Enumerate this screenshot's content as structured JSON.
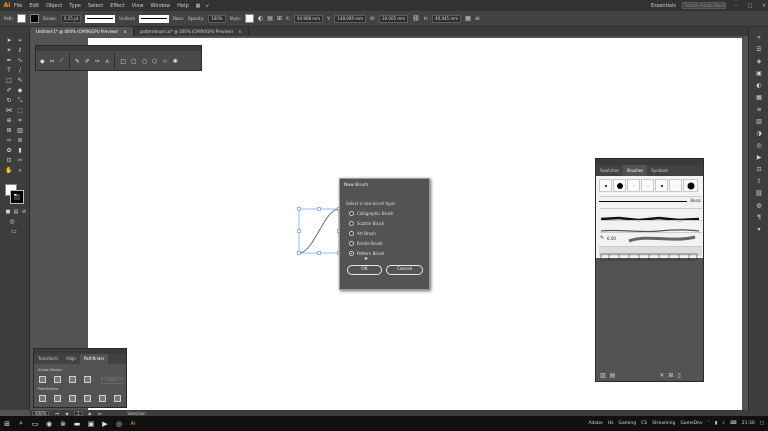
{
  "app": {
    "logo": "Ai"
  },
  "menu": [
    "File",
    "Edit",
    "Object",
    "Type",
    "Select",
    "Effect",
    "View",
    "Window",
    "Help"
  ],
  "workspace": "Essentials",
  "search_placeholder": "Search Adobe Stock",
  "control": {
    "selection_label": "Path",
    "stroke_label": "Stroke:",
    "stroke_value": "0.25 pt",
    "profile_label": "Uniform",
    "brush_label": "Basic",
    "opacity_label": "Opacity:",
    "opacity_value": "100%",
    "style_label": "Style:",
    "x_label": "X:",
    "x_value": "94.908 mm",
    "y_label": "Y:",
    "y_value": "148.009 mm",
    "w_label": "W:",
    "w_value": "30.005 mm",
    "h_label": "H:",
    "h_value": "40.045 mm"
  },
  "tabs": [
    {
      "label": "Untitled-1* @ 400% (CMYK/GPU Preview)",
      "close": "×"
    },
    {
      "label": "patternbrush.ai* @ 300% (CMYK/GPU Preview)",
      "close": "×"
    }
  ],
  "dialog": {
    "title": "New Brush",
    "prompt": "Select a new brush type:",
    "options": [
      "Calligraphic Brush",
      "Scatter Brush",
      "Art Brush",
      "Bristle Brush",
      "Pattern Brush"
    ],
    "selected_index": 4,
    "ok_label": "OK",
    "cancel_label": "Cancel"
  },
  "brushes_panel": {
    "tabs": [
      "Swatches",
      "Brushes",
      "Symbols"
    ],
    "active_tab": 1,
    "basic_label": "Basic",
    "bristle_value": "6.00",
    "footer_icons": [
      "library-icon",
      "options-icon",
      "remove-icon",
      "new-icon",
      "delete-icon"
    ]
  },
  "pathfinder_panel": {
    "tabs": [
      "Transform",
      "Align",
      "Pathfinder"
    ],
    "active_tab": 2,
    "shape_modes_label": "Shape Modes:",
    "pathfinders_label": "Pathfinders:",
    "expand_label": "Expand"
  },
  "status": {
    "zoom": "400%",
    "page": "1",
    "tool": "Selection"
  },
  "taskbar": {
    "labels": [
      "Adobe",
      "Hz",
      "Gaming",
      "CS",
      "Streaming",
      "GameDev"
    ],
    "time": "21:30"
  }
}
